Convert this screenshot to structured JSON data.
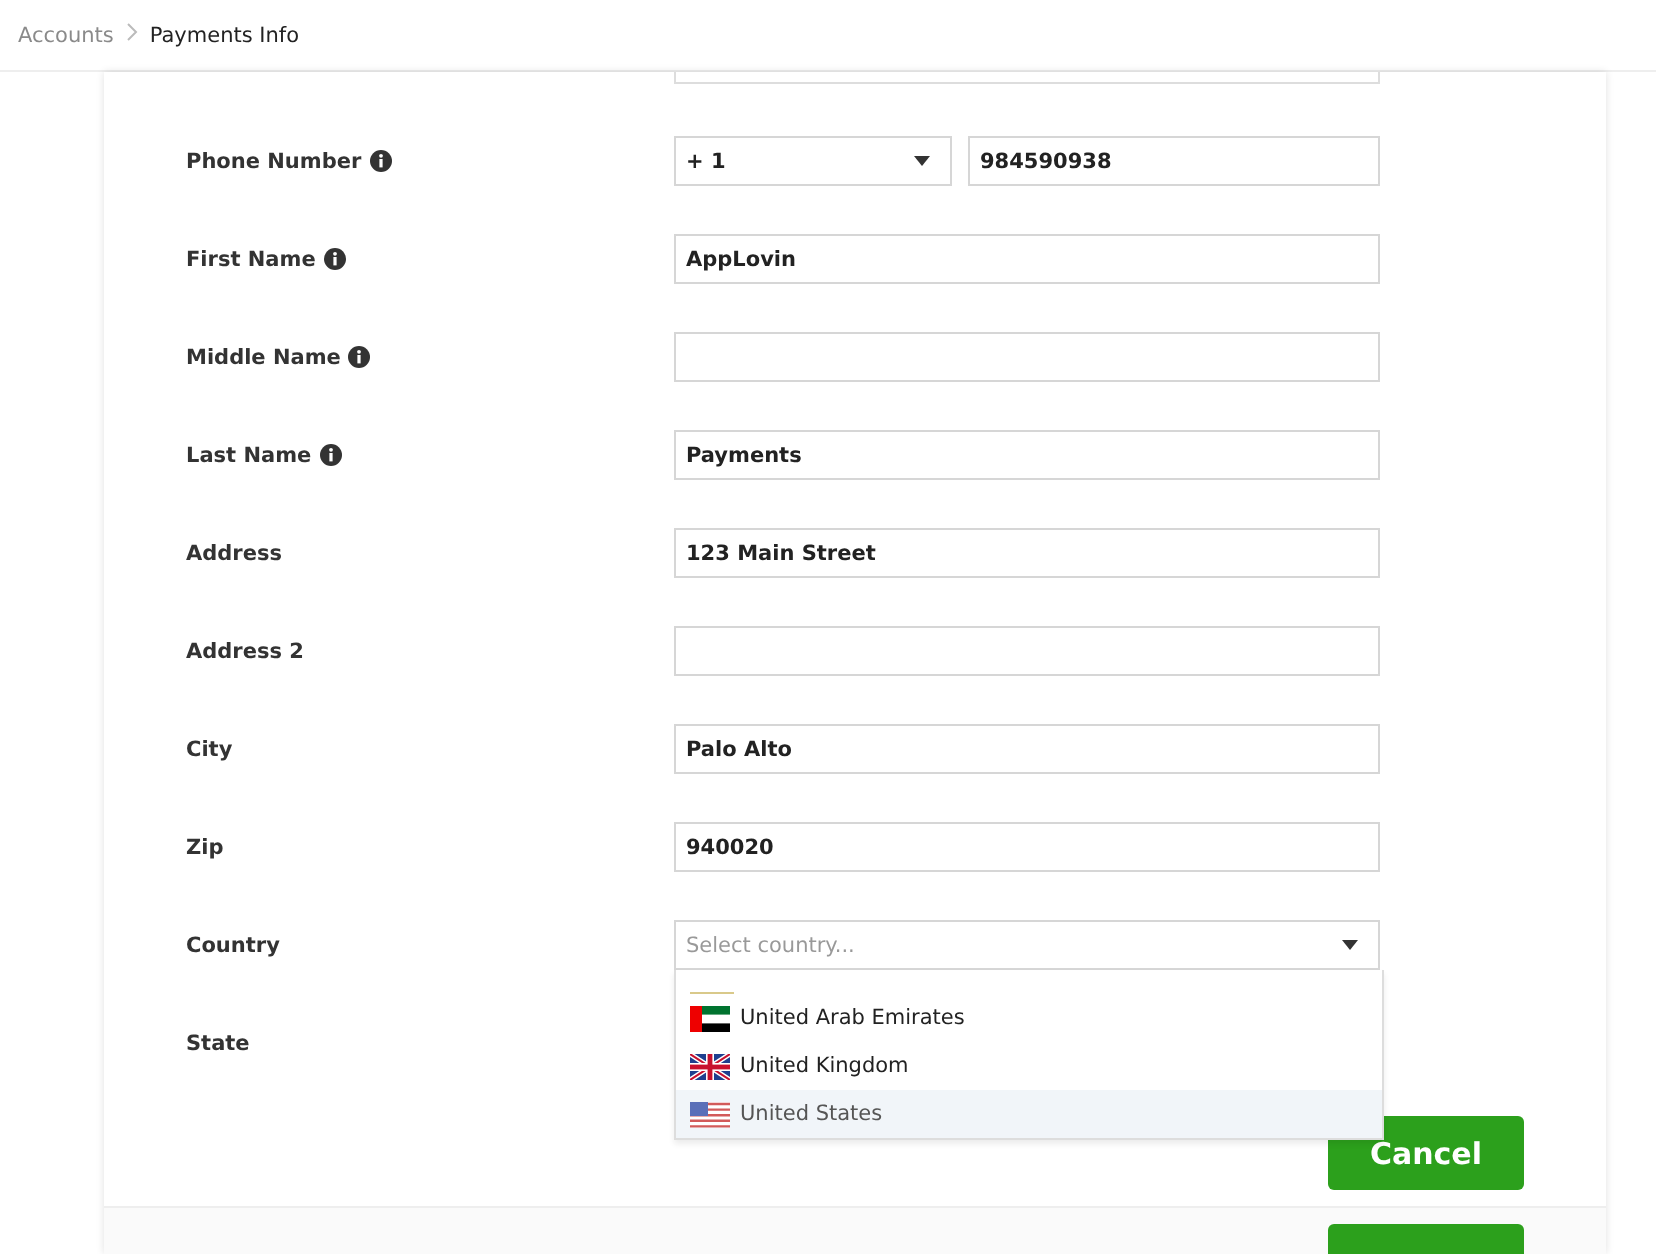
{
  "breadcrumb": [
    {
      "label": "Accounts",
      "current": false
    },
    {
      "label": "Payments Info",
      "current": true
    }
  ],
  "fields": [
    {
      "kind": "phone",
      "label": "Phone Number",
      "info": true,
      "code": "+ 1",
      "value": "984590938"
    },
    {
      "kind": "text",
      "label": "First Name",
      "info": true,
      "value": "AppLovin"
    },
    {
      "kind": "text",
      "label": "Middle Name",
      "info": true
    },
    {
      "kind": "text",
      "label": "Last Name",
      "info": true,
      "value": "Payments"
    },
    {
      "kind": "text",
      "label": "Address",
      "info": false,
      "value": "123 Main Street"
    },
    {
      "kind": "text",
      "label": "Address 2",
      "info": false
    },
    {
      "kind": "text",
      "label": "City",
      "info": false,
      "value": "Palo Alto"
    },
    {
      "kind": "text",
      "label": "Zip",
      "info": false,
      "value": "940020"
    },
    {
      "kind": "select",
      "label": "Country",
      "info": false,
      "placeholder": "Select country..."
    },
    {
      "kind": "none",
      "label": "State",
      "info": false
    }
  ],
  "country_options": [
    {
      "label": "United Arab Emirates",
      "selected": false
    },
    {
      "label": "United Kingdom",
      "selected": false
    },
    {
      "label": "United States",
      "selected": true
    }
  ],
  "buttons": [
    {
      "label": "Cancel"
    }
  ]
}
